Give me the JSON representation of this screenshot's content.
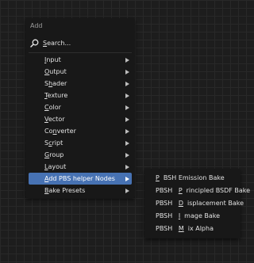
{
  "menu": {
    "title": "Add",
    "search_label": "Search...",
    "search_mnemonic": "S",
    "items": [
      {
        "label": "Input",
        "mnemonic": "I",
        "rest": "nput"
      },
      {
        "label": "Output",
        "mnemonic": "O",
        "rest": "utput"
      },
      {
        "label": "Shader",
        "mnemonic": "S",
        "rest": "hader"
      },
      {
        "label": "Texture",
        "mnemonic": "T",
        "rest": "exture"
      },
      {
        "label": "Color",
        "mnemonic": "C",
        "rest": "olor"
      },
      {
        "label": "Vector",
        "mnemonic": "V",
        "rest": "ector"
      },
      {
        "label": "Converter",
        "mnemonic": "C",
        "rest": "onverter"
      },
      {
        "label": "Script",
        "mnemonic": "S",
        "rest": "cript"
      },
      {
        "label": "Group",
        "mnemonic": "G",
        "rest": "roup"
      },
      {
        "label": "Layout",
        "mnemonic": "L",
        "rest": "ayout"
      },
      {
        "label": "Add PBS helper Nodes",
        "mnemonic": "A",
        "rest": "dd PBS helper Nodes"
      },
      {
        "label": "Bake Presets",
        "mnemonic": "B",
        "rest": "ake Presets"
      }
    ],
    "active_item": "Add PBS helper Nodes"
  },
  "submenu": {
    "items": [
      {
        "label": "PBSH Emission Bake",
        "pre": "",
        "mnemonic": "P",
        "rest": "BSH Emission Bake"
      },
      {
        "label": "PBSH Principled BSDF Bake",
        "pre": "PBSH ",
        "mnemonic": "P",
        "rest": "rincipled BSDF Bake"
      },
      {
        "label": "PBSH Displacement Bake",
        "pre": "PBSH ",
        "mnemonic": "D",
        "rest": "isplacement Bake"
      },
      {
        "label": "PBSH Image Bake",
        "pre": "PBSH ",
        "mnemonic": "I",
        "rest": "mage Bake"
      },
      {
        "label": "PBSH Mix Alpha",
        "pre": "PBSH ",
        "mnemonic": "M",
        "rest": "ix Alpha"
      }
    ]
  },
  "icons": {
    "search": "magnifier-icon",
    "submenu_arrow": "triangle-right-icon"
  },
  "colors": {
    "background": "#1d1d1d",
    "menu_background": "#181818",
    "highlight": "#4772b3",
    "text": "#e2e2e2",
    "title_text": "#9b9b9b"
  }
}
